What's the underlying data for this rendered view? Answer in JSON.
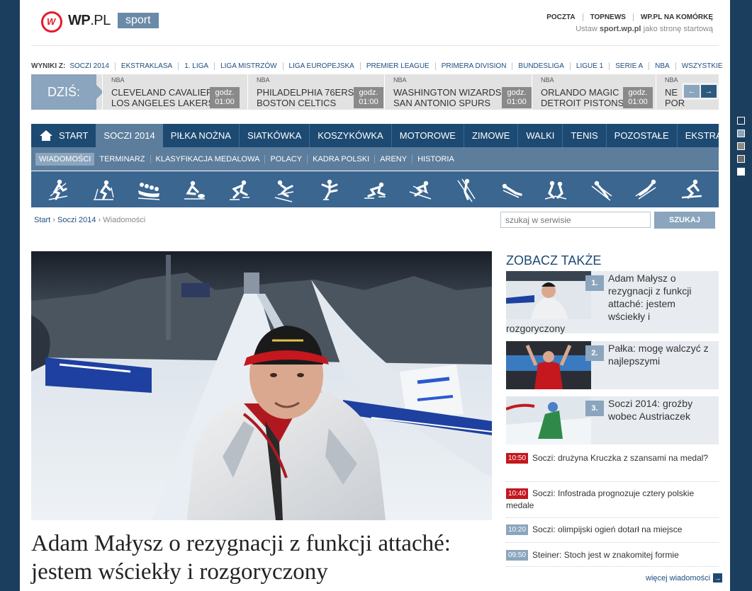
{
  "header": {
    "logo_text_bold": "WP",
    "logo_text_light": ".PL",
    "logo_mark": "W",
    "section_tag": "sport",
    "top_links": [
      "POCZTA",
      "TOPNEWS",
      "WP.PL NA KOMÓRKĘ"
    ],
    "set_home_prefix": "Ustaw",
    "set_home_domain": "sport.wp.pl",
    "set_home_suffix": "jako stronę startową"
  },
  "results_bar": {
    "label": "WYNIKI Z:",
    "links": [
      "SOCZI 2014",
      "EKSTRAKLASA",
      "1. LIGA",
      "LIGA MISTRZÓW",
      "LIGA EUROPEJSKA",
      "PREMIER LEAGUE",
      "PRIMERA DIVISION",
      "BUNDESLIGA",
      "LIGUE 1",
      "SERIE A",
      "NBA",
      "WSZYSTKIE"
    ]
  },
  "scores": {
    "today_label": "DZIŚ:",
    "games": [
      {
        "league": "NBA",
        "team1": "CLEVELAND CAVALIERS",
        "team2": "LOS ANGELES LAKERS",
        "time_label": "godz.",
        "time": "01:00"
      },
      {
        "league": "NBA",
        "team1": "PHILADELPHIA 76ERS",
        "team2": "BOSTON CELTICS",
        "time_label": "godz.",
        "time": "01:00"
      },
      {
        "league": "NBA",
        "team1": "WASHINGTON WIZARDS",
        "team2": "SAN ANTONIO SPURS",
        "time_label": "godz.",
        "time": "01:00"
      },
      {
        "league": "NBA",
        "team1": "ORLANDO MAGIC",
        "team2": "DETROIT PISTONS",
        "time_label": "godz.",
        "time": "01:00"
      },
      {
        "league": "NBA",
        "team1": "NE",
        "team2": "POR",
        "time_label": "",
        "time": ""
      }
    ],
    "prev_icon": "←",
    "next_icon": "→"
  },
  "side_dots_colors": [
    "#1c3e5e",
    "#8aa5bd",
    "#8a8a80",
    "#6a6a6a",
    "#ffffff"
  ],
  "main_nav": {
    "items": [
      "START",
      "SOCZI 2014",
      "PIŁKA NOŻNA",
      "SIATKÓWKA",
      "KOSZYKÓWKA",
      "MOTOROWE",
      "ZIMOWE",
      "WALKI",
      "TENIS",
      "POZOSTAŁE",
      "EKSTRA"
    ],
    "active": "SOCZI 2014"
  },
  "sub_nav": {
    "items": [
      "WIADOMOŚCI",
      "TERMINARZ",
      "KLASYFIKACJA MEDALOWA",
      "POLACY",
      "KADRA POLSKI",
      "ARENY",
      "HISTORIA"
    ],
    "active": "WIADOMOŚCI"
  },
  "sport_icons": [
    "biathlon-icon",
    "cross-country-icon",
    "bobsleigh-icon",
    "curling-icon",
    "speed-skating-icon",
    "freestyle-icon",
    "figure-skating-icon",
    "short-track-icon",
    "alpine-skiing-icon",
    "ski-jumping-icon",
    "luge-icon",
    "ice-hockey-icon",
    "nordic-combined-icon",
    "skeleton-icon",
    "snowboard-icon"
  ],
  "breadcrumb": [
    "Start",
    "Soczi 2014",
    "Wiadomości"
  ],
  "search": {
    "placeholder": "szukaj w serwisie",
    "button": "SZUKAJ"
  },
  "article": {
    "headline": "Adam Małysz o rezygnacji z funkcji attaché: jestem wściekły i rozgoryczony"
  },
  "see_also": {
    "title": "ZOBACZ TAKŻE",
    "items": [
      {
        "num": "1.",
        "title": "Adam Małysz o rezygnacji z funkcji attaché: jestem wściekły i",
        "tail": "rozgoryczony"
      },
      {
        "num": "2.",
        "title": "Pałka: mogę walczyć z najlepszymi"
      },
      {
        "num": "3.",
        "title": "Soczi 2014: groźby wobec Austriaczek"
      }
    ]
  },
  "news": [
    {
      "time": "10:50",
      "title": "Soczi: drużyna Kruczka z szansami na medal?",
      "color": "red"
    },
    {
      "time": "10:40",
      "title": "Soczi: Infostrada prognozuje cztery polskie medale",
      "color": "red"
    },
    {
      "time": "10:20",
      "title": "Soczi: olimpijski ogień dotarł na miejsce",
      "color": "grey"
    },
    {
      "time": "09:50",
      "title": "Steiner: Stoch jest w znakomitej formie",
      "color": "grey"
    }
  ],
  "more_news": "więcej wiadomości",
  "colors": {
    "navy": "#1d4a72",
    "steel": "#5d7d9c",
    "light_steel": "#8aa5bd",
    "red": "#c4171e",
    "brand_red": "#e8192c"
  }
}
